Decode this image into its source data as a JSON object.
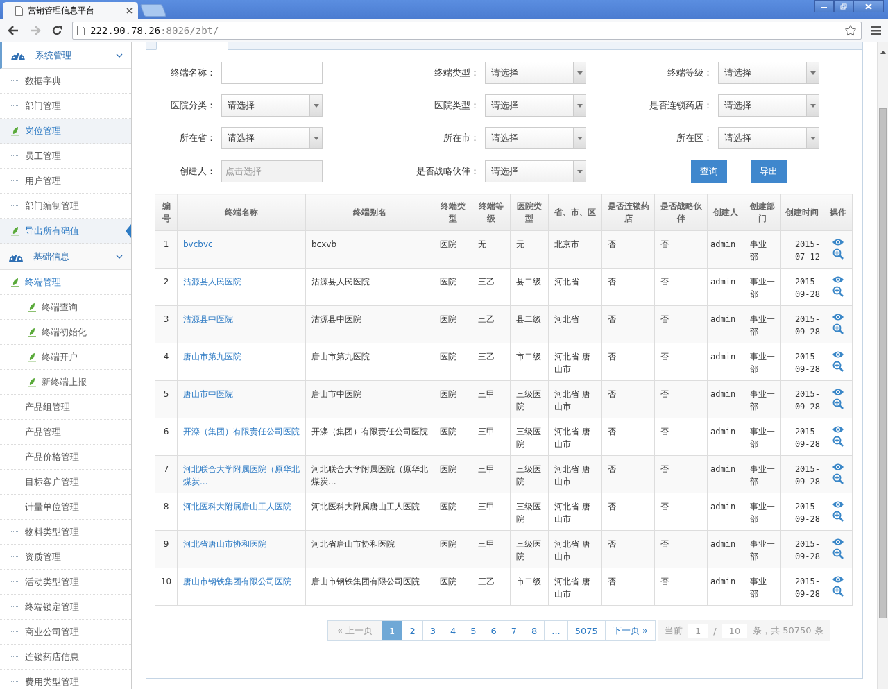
{
  "browser": {
    "tab_title": "营销管理信息平台",
    "url_host": "222.90.78.26",
    "url_path": ":8026/zbt/"
  },
  "sidebar": [
    {
      "title": "系统管理",
      "expanded": true,
      "items": [
        {
          "label": "数据字典",
          "kind": "dot",
          "highlighted": false,
          "selected": false
        },
        {
          "label": "部门管理",
          "kind": "dot",
          "highlighted": false,
          "selected": false
        },
        {
          "label": "岗位管理",
          "kind": "leaf",
          "highlighted": true,
          "selected": false
        },
        {
          "label": "员工管理",
          "kind": "dot",
          "highlighted": false,
          "selected": false
        },
        {
          "label": "用户管理",
          "kind": "dot",
          "highlighted": false,
          "selected": false
        },
        {
          "label": "部门编制管理",
          "kind": "dot",
          "highlighted": false,
          "selected": false
        },
        {
          "label": "导出所有码值",
          "kind": "leaf",
          "highlighted": true,
          "selected": true
        }
      ]
    },
    {
      "title": "基础信息",
      "expanded": true,
      "items": [
        {
          "label": "终端管理",
          "kind": "leaf",
          "highlighted": false,
          "selected": false,
          "expanded": true,
          "children": [
            {
              "label": "终端查询",
              "kind": "leaf",
              "highlighted": false
            },
            {
              "label": "终端初始化",
              "kind": "leaf",
              "highlighted": false
            },
            {
              "label": "终端开户",
              "kind": "leaf",
              "highlighted": false
            },
            {
              "label": "新终端上报",
              "kind": "leaf",
              "highlighted": false
            }
          ]
        },
        {
          "label": "产品组管理",
          "kind": "dot",
          "highlighted": false,
          "selected": false
        },
        {
          "label": "产品管理",
          "kind": "dot",
          "highlighted": false,
          "selected": false
        },
        {
          "label": "产品价格管理",
          "kind": "dot",
          "highlighted": false,
          "selected": false
        },
        {
          "label": "目标客户管理",
          "kind": "dot",
          "highlighted": false,
          "selected": false
        },
        {
          "label": "计量单位管理",
          "kind": "dot",
          "highlighted": false,
          "selected": false
        },
        {
          "label": "物料类型管理",
          "kind": "dot",
          "highlighted": false,
          "selected": false
        },
        {
          "label": "资质管理",
          "kind": "dot",
          "highlighted": false,
          "selected": false
        },
        {
          "label": "活动类型管理",
          "kind": "dot",
          "highlighted": false,
          "selected": false
        },
        {
          "label": "终端锁定管理",
          "kind": "dot",
          "highlighted": false,
          "selected": false
        },
        {
          "label": "商业公司管理",
          "kind": "dot",
          "highlighted": false,
          "selected": false
        },
        {
          "label": "连锁药店信息",
          "kind": "dot",
          "highlighted": false,
          "selected": false
        },
        {
          "label": "费用类型管理",
          "kind": "dot",
          "highlighted": false,
          "selected": false
        }
      ]
    }
  ],
  "filters": [
    {
      "label": "终端名称：",
      "kind": "text"
    },
    {
      "label": "终端类型：",
      "kind": "select",
      "value": "请选择"
    },
    {
      "label": "终端等级：",
      "kind": "select",
      "value": "请选择"
    },
    {
      "label": "医院分类：",
      "kind": "select",
      "value": "请选择"
    },
    {
      "label": "医院类型：",
      "kind": "select",
      "value": "请选择"
    },
    {
      "label": "是否连锁药店：",
      "kind": "select",
      "value": "请选择"
    },
    {
      "label": "所在省：",
      "kind": "select",
      "value": "请选择"
    },
    {
      "label": "所在市：",
      "kind": "select",
      "value": "请选择"
    },
    {
      "label": "所在区：",
      "kind": "select",
      "value": "请选择"
    },
    {
      "label": "创建人：",
      "kind": "picker",
      "placeholder": "点击选择"
    },
    {
      "label": "是否战略伙伴：",
      "kind": "select",
      "value": "请选择"
    }
  ],
  "buttons": [
    "查询",
    "导出"
  ],
  "table": {
    "columns": [
      "编号",
      "终端名称",
      "终端别名",
      "终端类型",
      "终端等级",
      "医院类型",
      "省、市、区",
      "是否连锁药店",
      "是否战略伙伴",
      "创建人",
      "创建部门",
      "创建时间",
      "操作"
    ],
    "rows": [
      [
        "1",
        "bvcbvc",
        "bcxvb",
        "医院",
        "无",
        "无",
        "北京市",
        "否",
        "否",
        "admin",
        "事业一部",
        "2015-07-12"
      ],
      [
        "2",
        "沽源县人民医院",
        "沽源县人民医院",
        "医院",
        "三乙",
        "县二级",
        "河北省",
        "否",
        "否",
        "admin",
        "事业一部",
        "2015-09-28"
      ],
      [
        "3",
        "沽源县中医院",
        "沽源县中医院",
        "医院",
        "三乙",
        "县二级",
        "河北省",
        "否",
        "否",
        "admin",
        "事业一部",
        "2015-09-28"
      ],
      [
        "4",
        "唐山市第九医院",
        "唐山市第九医院",
        "医院",
        "三乙",
        "市二级",
        "河北省 唐山市",
        "否",
        "否",
        "admin",
        "事业一部",
        "2015-09-28"
      ],
      [
        "5",
        "唐山市中医院",
        "唐山市中医院",
        "医院",
        "三甲",
        "三级医院",
        "河北省 唐山市",
        "否",
        "否",
        "admin",
        "事业一部",
        "2015-09-28"
      ],
      [
        "6",
        "开滦（集团）有限责任公司医院",
        "开滦（集团）有限责任公司医院",
        "医院",
        "三甲",
        "三级医院",
        "河北省 唐山市",
        "否",
        "否",
        "admin",
        "事业一部",
        "2015-09-28"
      ],
      [
        "7",
        "河北联合大学附属医院（原华北煤炭...",
        "河北联合大学附属医院（原华北煤炭...",
        "医院",
        "三甲",
        "三级医院",
        "河北省 唐山市",
        "否",
        "否",
        "admin",
        "事业一部",
        "2015-09-28"
      ],
      [
        "8",
        "河北医科大附属唐山工人医院",
        "河北医科大附属唐山工人医院",
        "医院",
        "三甲",
        "三级医院",
        "河北省 唐山市",
        "否",
        "否",
        "admin",
        "事业一部",
        "2015-09-28"
      ],
      [
        "9",
        "河北省唐山市协和医院",
        "河北省唐山市协和医院",
        "医院",
        "三甲",
        "三级医院",
        "河北省 唐山市",
        "否",
        "否",
        "admin",
        "事业一部",
        "2015-09-28"
      ],
      [
        "10",
        "唐山市钢铁集团有限公司医院",
        "唐山市钢铁集团有限公司医院",
        "医院",
        "三乙",
        "市二级",
        "河北省 唐山市",
        "否",
        "否",
        "admin",
        "事业一部",
        "2015-09-28"
      ]
    ]
  },
  "pagination": {
    "prev": "« 上一页",
    "prev_disabled": true,
    "pages": [
      {
        "label": "1",
        "selected": true
      },
      {
        "label": "2",
        "selected": false
      },
      {
        "label": "3",
        "selected": false
      },
      {
        "label": "4",
        "selected": false
      },
      {
        "label": "5",
        "selected": false
      },
      {
        "label": "6",
        "selected": false
      },
      {
        "label": "7",
        "selected": false
      },
      {
        "label": "8",
        "selected": false
      },
      {
        "label": "...",
        "selected": false
      },
      {
        "label": "5075",
        "selected": false
      }
    ],
    "next": "下一页 »",
    "current_label": "当前",
    "current_page": "1",
    "separator": "/",
    "page_size": "10",
    "total": "条，共 50750 条"
  }
}
